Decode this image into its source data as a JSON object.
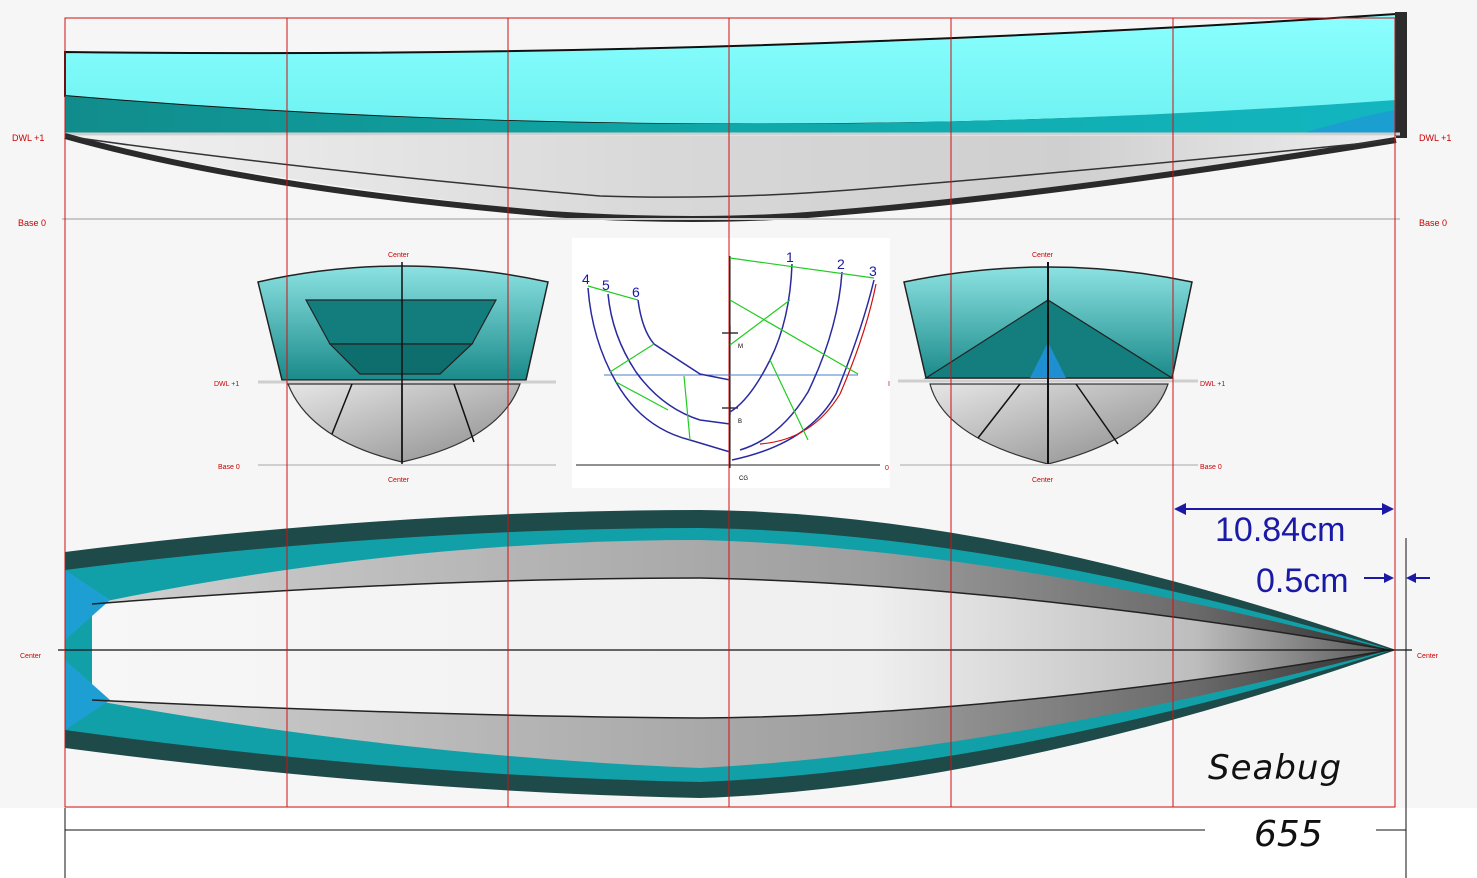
{
  "drawing": {
    "model_name": "Seabug",
    "overall_length": "655",
    "dimensions": {
      "station_spacing": "10.84cm",
      "offset": "0.5cm"
    },
    "waterline_labels": {
      "dwl": "DWL +1",
      "base": "Base 0",
      "center": "Center"
    },
    "body_plan": {
      "stations_forward": [
        "1",
        "2",
        "3"
      ],
      "stations_aft": [
        "4",
        "5",
        "6"
      ],
      "markers": {
        "metacenter": "M",
        "buoyancy": "B",
        "gravity": "CG"
      },
      "baseline_right": "0"
    },
    "colors": {
      "hull_cyan": "#7ffafa",
      "hull_teal": "#0fa4a4",
      "hull_dark": "#173d3d",
      "grid_red": "#d01010",
      "dimension_blue": "#1a1aa6"
    }
  }
}
